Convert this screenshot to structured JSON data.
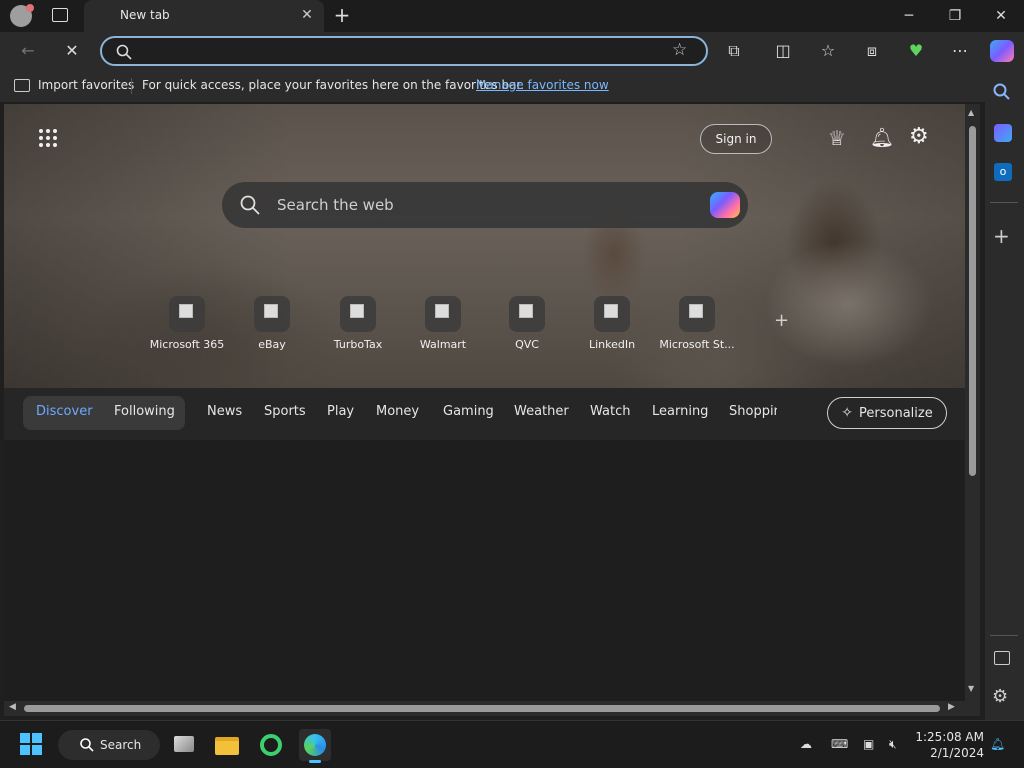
{
  "tab": {
    "title": "New tab"
  },
  "window": {
    "minimize": "─",
    "restore": "❐",
    "close": "✕"
  },
  "omnibox": {
    "value": "",
    "placeholder": ""
  },
  "favorites_bar": {
    "import_label": "Import favorites",
    "hint": "For quick access, place your favorites here on the favorites bar.",
    "manage_link": "Manage favorites now"
  },
  "newtab": {
    "sign_in": "Sign in",
    "search_placeholder": "Search the web",
    "tiles": [
      "Microsoft 365",
      "eBay",
      "TurboTax",
      "Walmart",
      "QVC",
      "LinkedIn",
      "Microsoft St..."
    ],
    "feed_tabs": [
      "Discover",
      "Following"
    ],
    "nav": [
      "News",
      "Sports",
      "Play",
      "Money",
      "Gaming",
      "Weather",
      "Watch",
      "Learning",
      "Shoppir"
    ],
    "personalize": "Personalize"
  },
  "taskbar": {
    "search_label": "Search",
    "time": "1:25:08 AM",
    "date": "2/1/2024"
  },
  "colors": {
    "accent": "#8ab4d8",
    "link": "#7ab7ff",
    "active_tab_text": "#6ea8ff"
  }
}
